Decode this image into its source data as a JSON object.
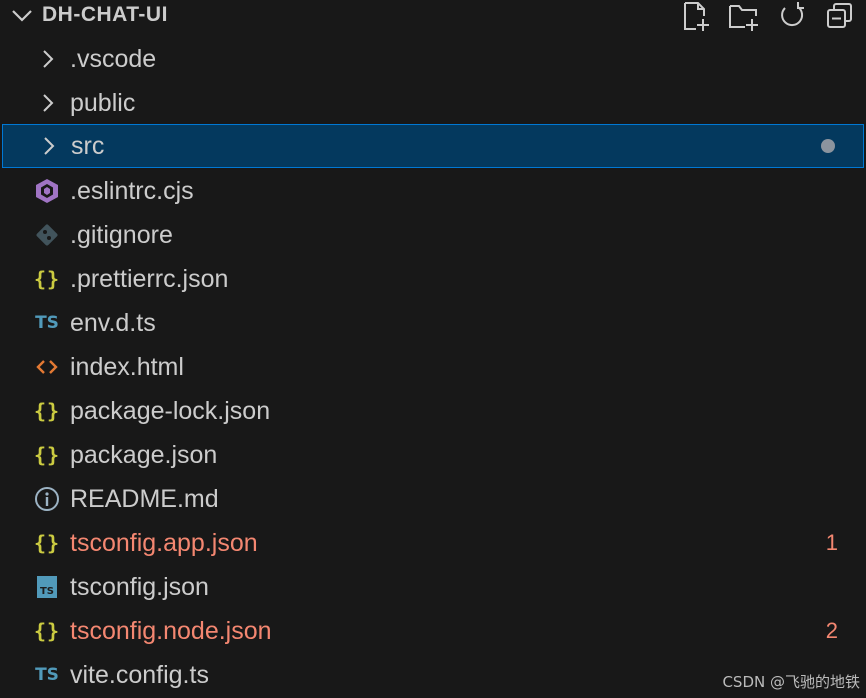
{
  "explorer": {
    "title": "DH-CHAT-UI",
    "actions": [
      {
        "name": "new-file-icon"
      },
      {
        "name": "new-folder-icon"
      },
      {
        "name": "refresh-icon"
      },
      {
        "name": "collapse-all-icon"
      }
    ],
    "items": [
      {
        "label": ".vscode",
        "kind": "folder",
        "icon": "chevron-right-icon"
      },
      {
        "label": "public",
        "kind": "folder",
        "icon": "chevron-right-icon"
      },
      {
        "label": "src",
        "kind": "folder",
        "icon": "chevron-right-icon",
        "selected": true,
        "modified_dot": true
      },
      {
        "label": ".eslintrc.cjs",
        "kind": "file",
        "icon": "eslint-icon"
      },
      {
        "label": ".gitignore",
        "kind": "file",
        "icon": "git-icon"
      },
      {
        "label": ".prettierrc.json",
        "kind": "file",
        "icon": "json-icon",
        "icon_text": "{}"
      },
      {
        "label": "env.d.ts",
        "kind": "file",
        "icon": "typescript-icon",
        "icon_text": "TS"
      },
      {
        "label": "index.html",
        "kind": "file",
        "icon": "html-icon",
        "icon_text": "<>"
      },
      {
        "label": "package-lock.json",
        "kind": "file",
        "icon": "json-icon",
        "icon_text": "{}"
      },
      {
        "label": "package.json",
        "kind": "file",
        "icon": "json-icon",
        "icon_text": "{}"
      },
      {
        "label": "README.md",
        "kind": "file",
        "icon": "info-icon",
        "icon_text": "i"
      },
      {
        "label": "tsconfig.app.json",
        "kind": "file",
        "icon": "json-icon",
        "icon_text": "{}",
        "error": true,
        "badge": "1"
      },
      {
        "label": "tsconfig.json",
        "kind": "file",
        "icon": "tsconfig-icon",
        "icon_text": "TS"
      },
      {
        "label": "tsconfig.node.json",
        "kind": "file",
        "icon": "json-icon",
        "icon_text": "{}",
        "error": true,
        "badge": "2"
      },
      {
        "label": "vite.config.ts",
        "kind": "file",
        "icon": "typescript-icon",
        "icon_text": "TS"
      }
    ]
  },
  "watermark": "CSDN @飞驰的地铁",
  "colors": {
    "background": "#181818",
    "selection": "#04395e",
    "selection_border": "#0078d4",
    "error": "#f48771",
    "json_icon": "#cbcb41",
    "ts_icon": "#519aba",
    "html_icon": "#e37933",
    "eslint_icon": "#a074c4"
  }
}
